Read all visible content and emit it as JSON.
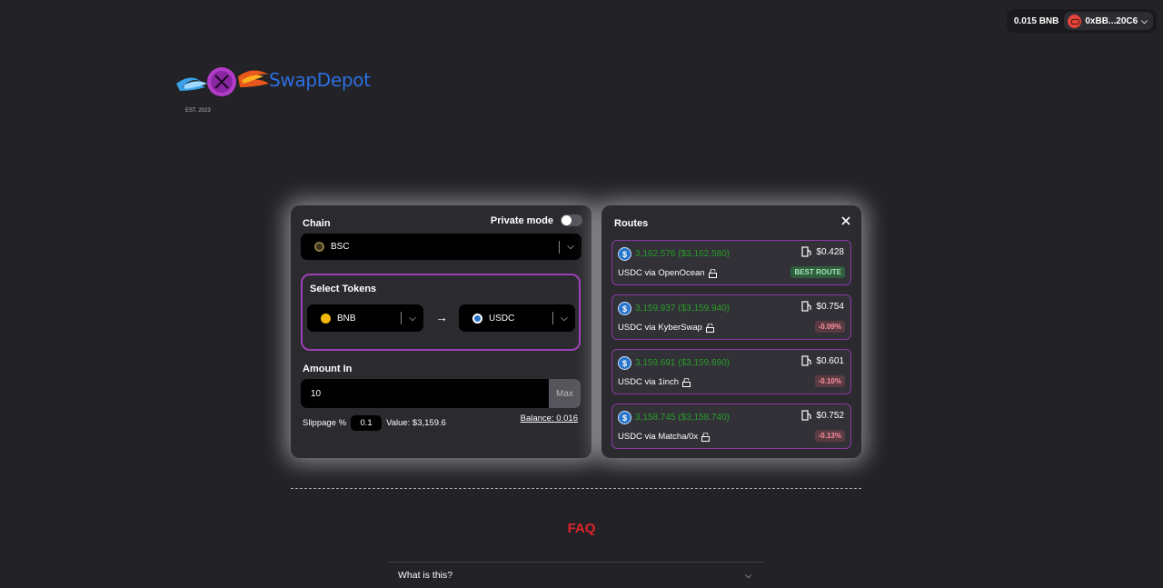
{
  "wallet": {
    "balance": "0.015 BNB",
    "address": "0xBB...20C6"
  },
  "logo": {
    "name": "SwapDepot",
    "est": "EST. 2023"
  },
  "swap": {
    "chain_label": "Chain",
    "private_mode_label": "Private mode",
    "chain_value": "BSC",
    "select_tokens_label": "Select Tokens",
    "token_from": "BNB",
    "token_to": "USDC",
    "amount_label": "Amount In",
    "amount_value": "10",
    "max_label": "Max",
    "slippage_label": "Slippage %",
    "slippage_value": "0.1",
    "value_text": "Value: $3,159.6",
    "balance_text": "Balance: 0.016"
  },
  "routes": {
    "title": "Routes",
    "items": [
      {
        "amount": "3,162.576 ($3,162.580)",
        "gas": "$0.428",
        "via": "USDC via OpenOcean",
        "badge": "BEST ROUTE"
      },
      {
        "amount": "3,159.937 ($3,159.940)",
        "gas": "$0.754",
        "via": "USDC via KyberSwap",
        "badge": "-0.09%"
      },
      {
        "amount": "3,159.691 ($3,159.690)",
        "gas": "$0.601",
        "via": "USDC via 1inch",
        "badge": "-0.10%"
      },
      {
        "amount": "3,158.745 ($3,158.740)",
        "gas": "$0.752",
        "via": "USDC via Matcha/0x",
        "badge": "-0.13%"
      }
    ]
  },
  "faq": {
    "title": "FAQ",
    "items": [
      {
        "question": "What is this?"
      }
    ]
  },
  "colors": {
    "background": "#222227",
    "panel": "#2a2a2f",
    "accent_border": "#9d3fb5",
    "amount_green": "#2a9d2a",
    "faq_red": "#e0242a",
    "logo_blue": "#2d6fe0"
  }
}
